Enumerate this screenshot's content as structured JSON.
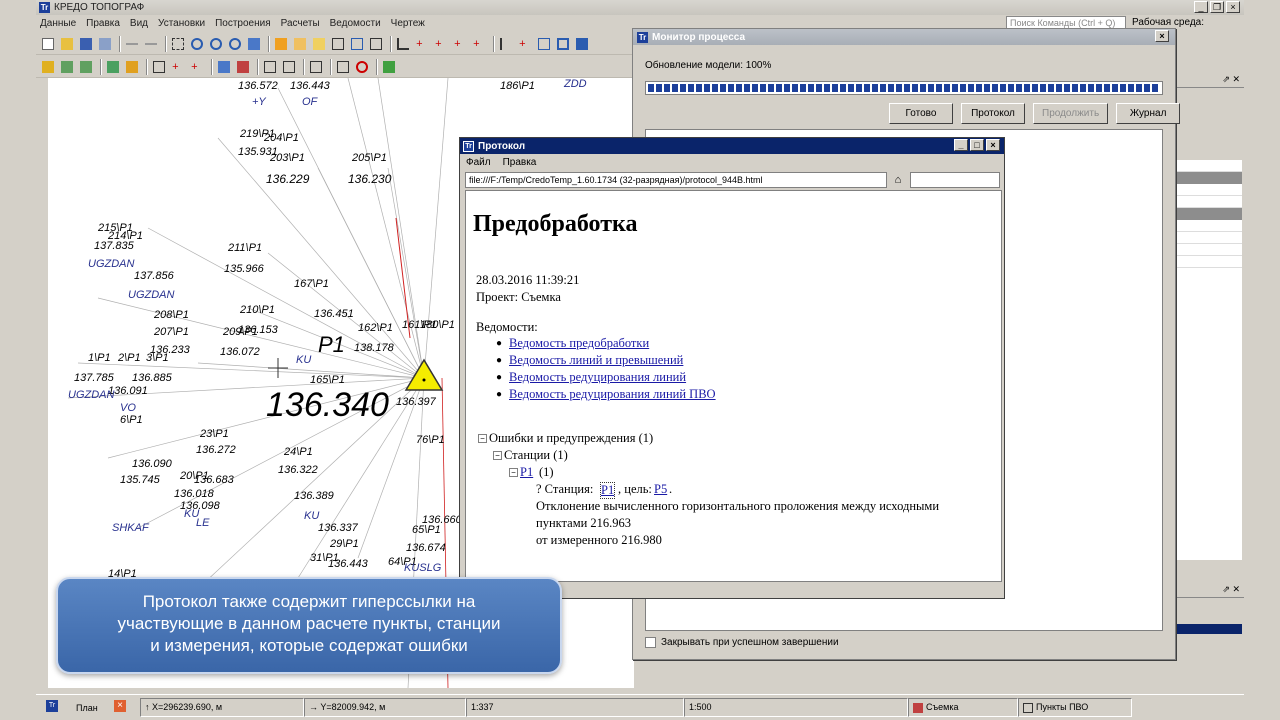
{
  "app": {
    "title": "КРЕДО ТОПОГРАФ",
    "icon": "credo-app-icon"
  },
  "menu": [
    "Данные",
    "Правка",
    "Вид",
    "Установки",
    "Построения",
    "Расчеты",
    "Ведомости",
    "Чертеж"
  ],
  "search": {
    "placeholder": "Поиск Команды (Ctrl + Q)"
  },
  "workspace_label": "Рабочая среда:",
  "map": {
    "labels": [
      {
        "t": "186\\P1"
      },
      {
        "t": "ZDD"
      },
      {
        "t": "136.572"
      },
      {
        "t": "136.443"
      },
      {
        "t": "+Y"
      },
      {
        "t": "OF"
      },
      {
        "t": "219\\P1"
      },
      {
        "t": "204\\P1"
      },
      {
        "t": "135.931"
      },
      {
        "t": "203\\P1"
      },
      {
        "t": "205\\P1"
      },
      {
        "t": "136.229"
      },
      {
        "t": "136.230"
      },
      {
        "t": "215\\P1"
      },
      {
        "t": "214\\P1"
      },
      {
        "t": "137.835"
      },
      {
        "t": "UGZDAN"
      },
      {
        "t": "211\\P1"
      },
      {
        "t": "135.966"
      },
      {
        "t": "137.856"
      },
      {
        "t": "UGZDAN"
      },
      {
        "t": "167\\P1"
      },
      {
        "t": "210\\P1"
      },
      {
        "t": "208\\P1"
      },
      {
        "t": "207\\P1"
      },
      {
        "t": "209\\P1"
      },
      {
        "t": "136.153"
      },
      {
        "t": "136.451"
      },
      {
        "t": "162\\P1"
      },
      {
        "t": "161\\P1"
      },
      {
        "t": "180\\P1"
      },
      {
        "t": "136.233"
      },
      {
        "t": "136.072"
      },
      {
        "t": "P1"
      },
      {
        "t": "138.178"
      },
      {
        "t": "1\\P1"
      },
      {
        "t": "2\\P1"
      },
      {
        "t": "3\\P1"
      },
      {
        "t": "137.785"
      },
      {
        "t": "136.885"
      },
      {
        "t": "165\\P1"
      },
      {
        "t": "136.091"
      },
      {
        "t": "UGZDAN"
      },
      {
        "t": "VO"
      },
      {
        "t": "136.340"
      },
      {
        "t": "136.397"
      },
      {
        "t": "KU"
      },
      {
        "t": "6\\P1"
      },
      {
        "t": "23\\P1"
      },
      {
        "t": "76\\P1"
      },
      {
        "t": "136.272"
      },
      {
        "t": "24\\P1"
      },
      {
        "t": "136.090"
      },
      {
        "t": "136.322"
      },
      {
        "t": "20\\P1"
      },
      {
        "t": "135.745"
      },
      {
        "t": "136.683"
      },
      {
        "t": "136.018"
      },
      {
        "t": "136.389"
      },
      {
        "t": "136.098"
      },
      {
        "t": "KU"
      },
      {
        "t": "LE"
      },
      {
        "t": "SHKAF"
      },
      {
        "t": "KU"
      },
      {
        "t": "136.337"
      },
      {
        "t": "29\\P1"
      },
      {
        "t": "31\\P1"
      },
      {
        "t": "136.443"
      },
      {
        "t": "64\\P1"
      },
      {
        "t": "KUSLG"
      },
      {
        "t": "65\\P1"
      },
      {
        "t": "136.660"
      },
      {
        "t": "136.674"
      },
      {
        "t": "14\\P1"
      }
    ]
  },
  "monitor": {
    "title": "Монитор процесса",
    "status": "Обновление модели:   100%",
    "progress_percent": 100,
    "buttons": {
      "done": "Готово",
      "protocol": "Протокол",
      "continue": "Продолжить",
      "journal": "Журнал"
    },
    "close_on_success": "Закрывать при успешном завершении"
  },
  "protocol": {
    "title": "Протокол",
    "menu": [
      "Файл",
      "Правка"
    ],
    "address": "file:///F:/Temp/CredoTemp_1.60.1734 (32-разрядная)/protocol_944B.html",
    "heading": "Предобработка",
    "date": "28.03.2016 11:39:21",
    "project": "Проект: Съемка",
    "reports_label": "Ведомости:",
    "reports": [
      "Ведомость предобработки",
      "Ведомость линий и превышений",
      "Ведомость редуцирования линий",
      "Ведомость редуцирования линий ПВО"
    ],
    "errors_node": "Ошибки и предупреждения (1)",
    "stations_node": "Станции (1)",
    "station_link": "P1",
    "station_count": "(1)",
    "msg_prefix": "? Станция:",
    "msg_station": "P1",
    "msg_target_label": ", цель:",
    "msg_target": "P5",
    "msg_dot": ".",
    "msg_line1": "Отклонение вычисленного горизонтального проложения между исходными",
    "msg_line2": "пунктами 216.963",
    "msg_line3": "от измеренного 216.980"
  },
  "callout": {
    "line1": "Протокол также содержит гиперссылки на",
    "line2": "участвующие в данном расчете пункты, станции",
    "line3": "и измерения, которые содержат ошибки"
  },
  "statusbar": {
    "tab": "План",
    "coord_x": "X=296239.690, м",
    "coord_y": "Y=82009.942, м",
    "scale1": "1:337",
    "scale2": "1:500",
    "layer1": "Съемка",
    "layer2": "Пункты ПВО"
  },
  "colors": {
    "titlebar_active": "#0a246a",
    "link": "#1a1aa6",
    "callout": "#4a76b8",
    "map_label_blue": "#27308e",
    "station_yellow": "#f4ec00"
  }
}
